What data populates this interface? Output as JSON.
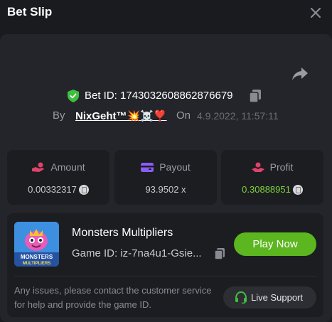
{
  "header": {
    "title": "Bet Slip"
  },
  "bet": {
    "id_text": "Bet ID: 1743032608862876679",
    "by_label": "By",
    "username": "NixGeht™💥☠️❣️",
    "on_label": "On",
    "date": "4.9.2022, 11:57:11"
  },
  "stats": [
    {
      "label": "Amount",
      "value": "0.00332317",
      "icon": "hand-coin-icon",
      "color": "#e0436a"
    },
    {
      "label": "Payout",
      "value": "93.9502 x",
      "icon": "wallet-icon",
      "color": "#8b5cf6"
    },
    {
      "label": "Profit",
      "value": "0.30888951",
      "icon": "profit-hand-icon",
      "color": "#e0436a",
      "value_color": "#7dd23c"
    }
  ],
  "game": {
    "name": "Monsters Multipliers",
    "thumb_text_1": "MONSTERS",
    "thumb_text_2": "MULTIPLIERS",
    "id_text": "Game ID: iz-7na4u1-Gsie...",
    "play_label": "Play Now",
    "help_text": "Any issues, please contact the customer service for help and provide the game ID.",
    "support_label": "Live Support"
  },
  "colors": {
    "accent_green": "#5cb61f",
    "profit_green": "#7dd23c",
    "background": "#1a1b1f",
    "panel": "#24252a",
    "card": "#1c1d21"
  }
}
